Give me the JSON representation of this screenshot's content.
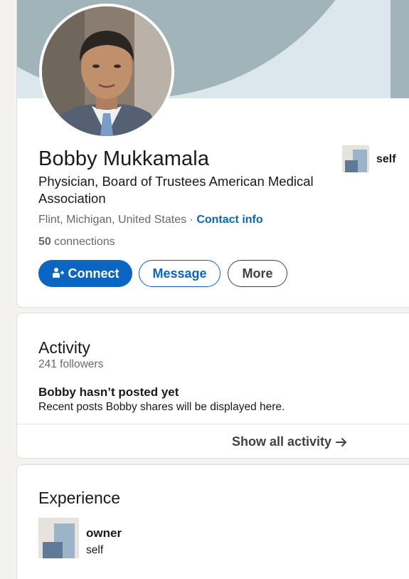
{
  "profile": {
    "name": "Bobby Mukkamala",
    "headline": "Physician, Board of Trustees American Medical Association",
    "location": "Flint, Michigan, United States",
    "separator": " · ",
    "contact_info": "Contact info",
    "connections_count": "50",
    "connections_label": " connections",
    "current_company": "self",
    "photo_icon": "profile-photo",
    "company_logo_icon": "company-logo-placeholder",
    "actions": {
      "connect": "Connect",
      "message": "Message",
      "more": "More"
    }
  },
  "activity": {
    "title": "Activity",
    "followers": "241 followers",
    "empty_title": "Bobby hasn’t posted yet",
    "empty_description": "Recent posts Bobby shares will be displayed here.",
    "show_all": "Show all activity"
  },
  "experience": {
    "title": "Experience",
    "items": [
      {
        "title": "owner",
        "company": "self"
      }
    ]
  },
  "colors": {
    "brand_blue": "#0a66c2",
    "banner_light": "#dbe7ea",
    "banner_dark": "#a0b4b9",
    "page_bg": "#f4f2ee"
  }
}
